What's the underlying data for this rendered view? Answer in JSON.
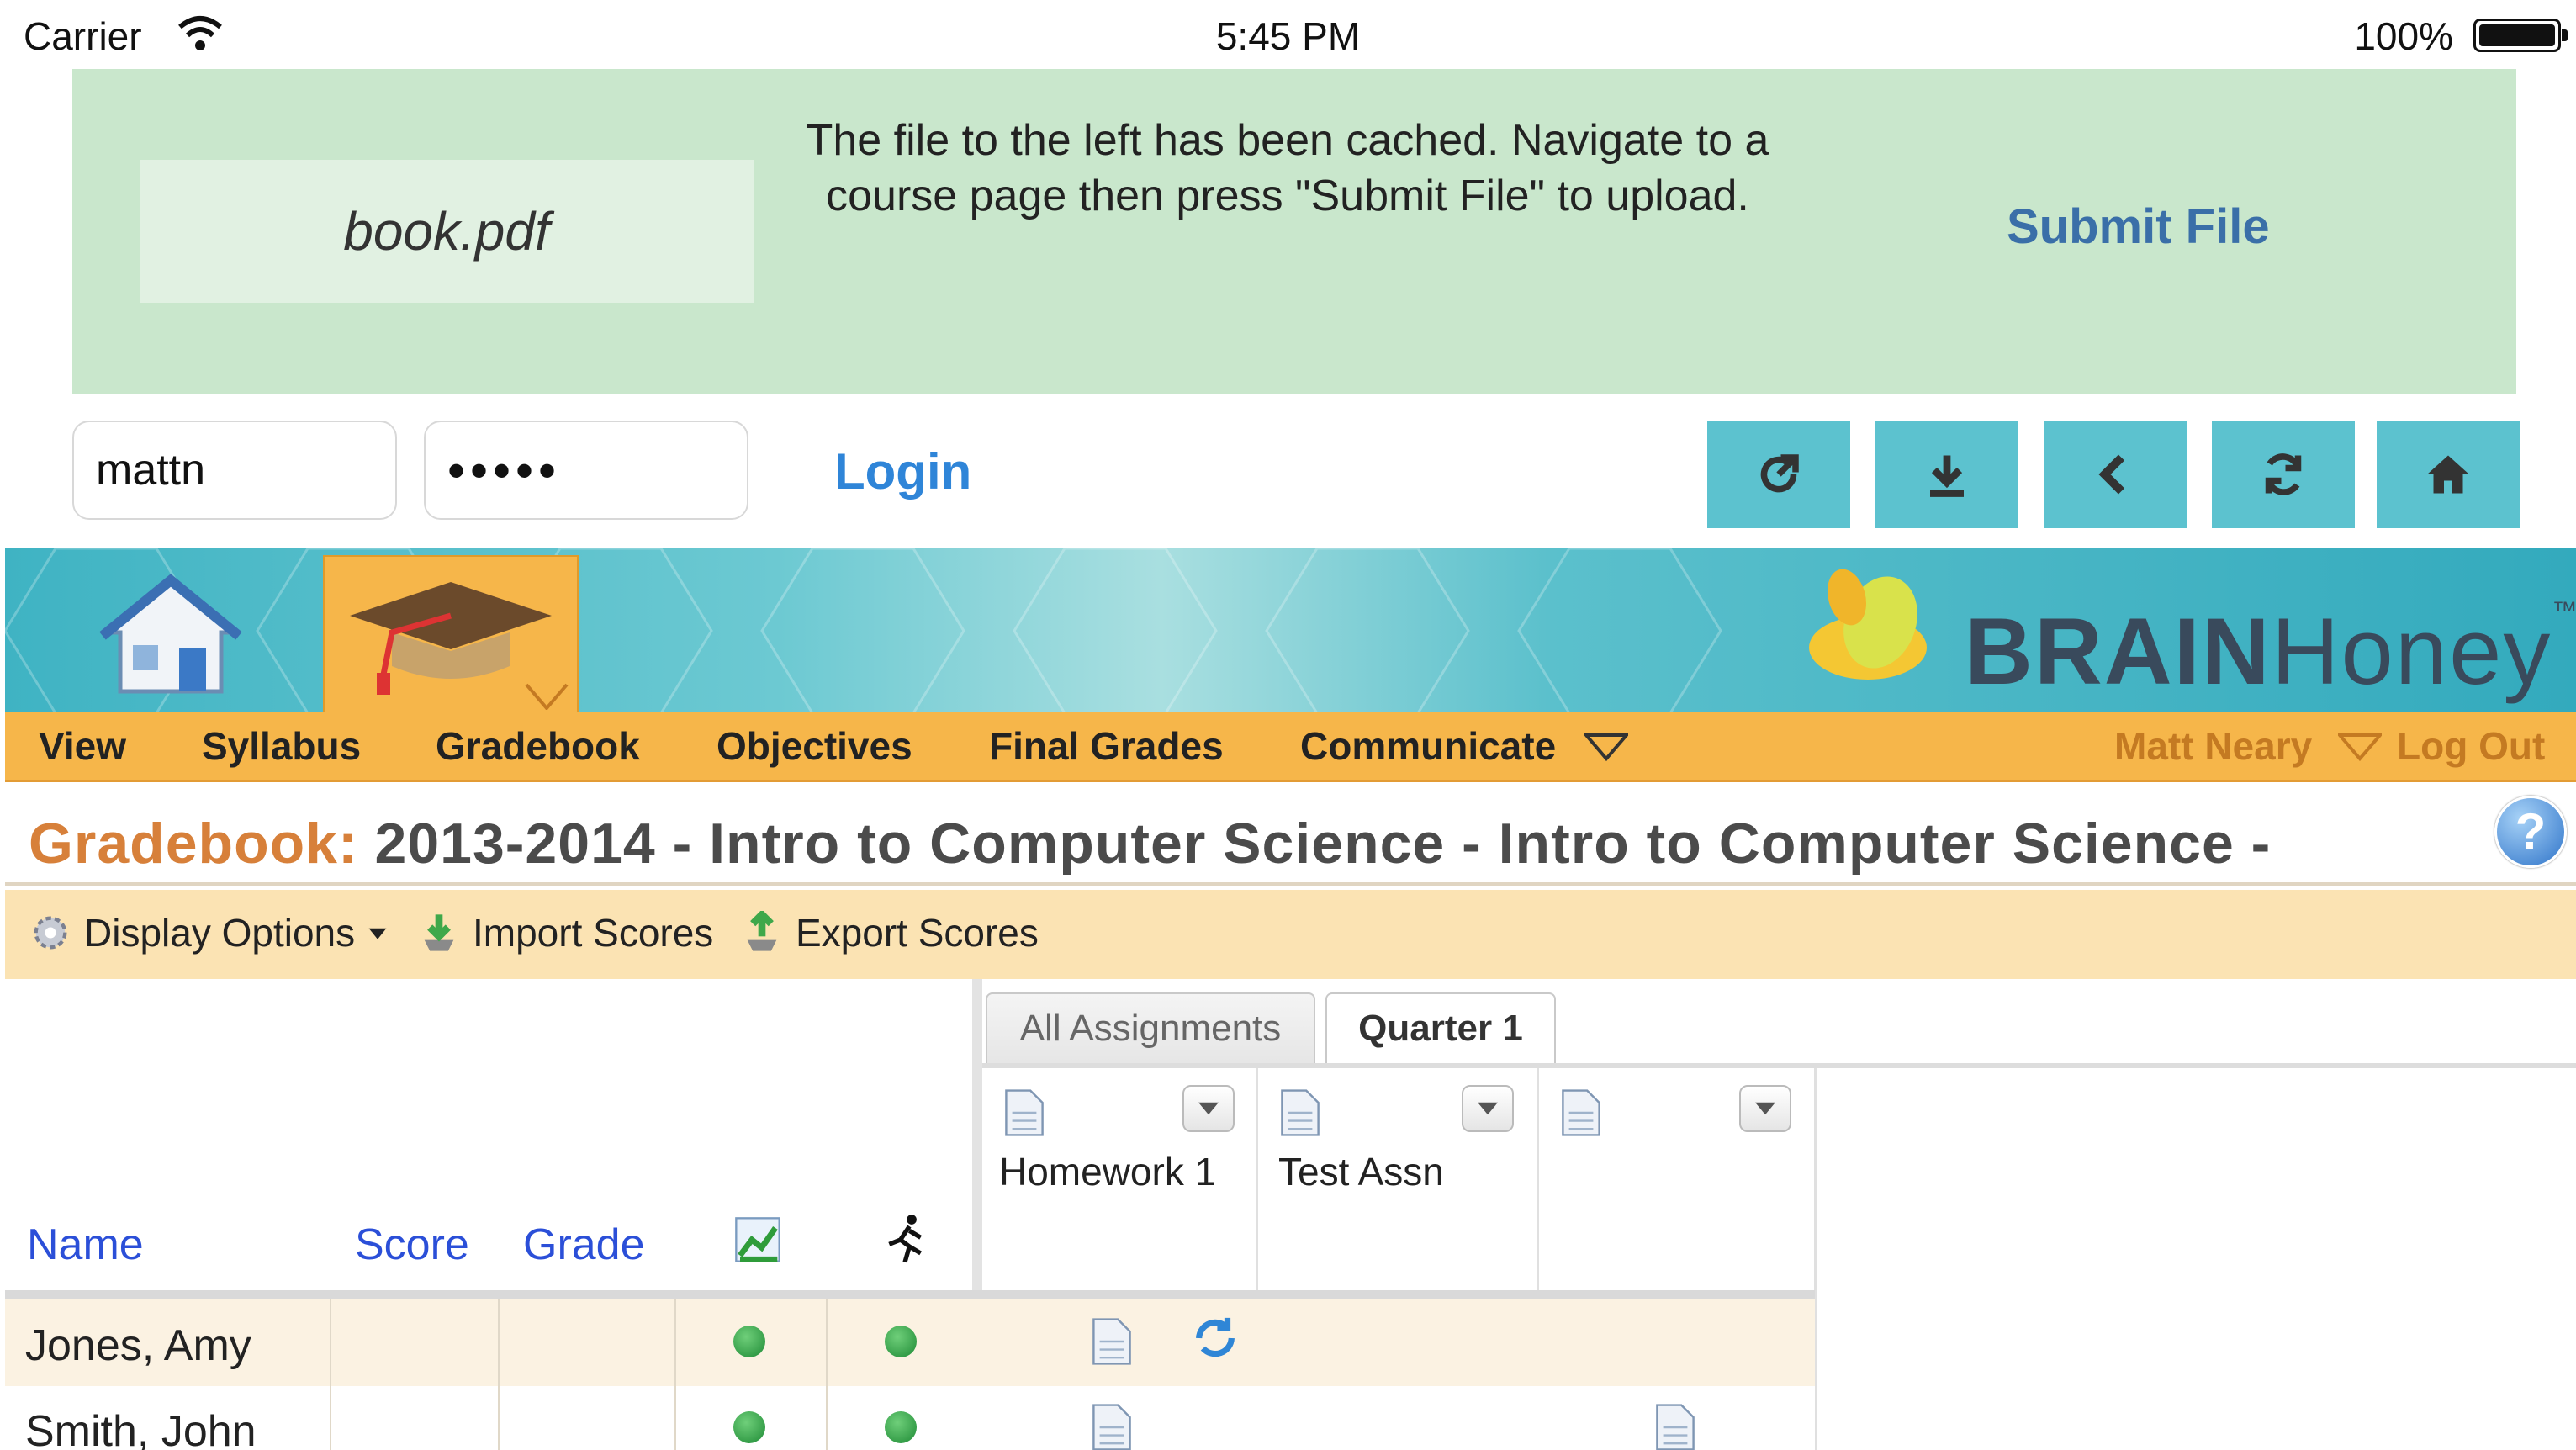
{
  "status_bar": {
    "carrier": "Carrier",
    "time": "5:45 PM",
    "battery": "100%"
  },
  "cache_banner": {
    "file_name": "book.pdf",
    "message": "The file to the left has been cached. Navigate to a course page then press \"Submit File\" to upload.",
    "submit_label": "Submit File"
  },
  "login": {
    "username": "mattn",
    "password_mask": "•••••",
    "login_label": "Login"
  },
  "toolbar_icons": [
    "share-icon",
    "download-icon",
    "back-icon",
    "refresh-icon",
    "home-icon"
  ],
  "brand": {
    "name_bold": "BRAIN",
    "name_light": "Honey",
    "trademark": "™"
  },
  "nav": {
    "items": [
      "View",
      "Syllabus",
      "Gradebook",
      "Objectives",
      "Final Grades",
      "Communicate"
    ],
    "user": "Matt Neary",
    "logout": "Log Out"
  },
  "page": {
    "title_label": "Gradebook:",
    "title_text": "2013-2014 - Intro to Computer Science - Intro to Computer Science -"
  },
  "options": {
    "display": "Display Options",
    "import": "Import Scores",
    "export": "Export Scores"
  },
  "grid": {
    "headers": {
      "name": "Name",
      "score": "Score",
      "grade": "Grade"
    },
    "tabs": [
      "All Assignments",
      "Quarter 1"
    ],
    "assignments": [
      "Homework 1",
      "Test Assn",
      ""
    ],
    "students": [
      "Jones, Amy",
      "Smith, John"
    ]
  },
  "colors": {
    "accent_orange": "#f6b64a",
    "banner_green": "#c9e7cc",
    "teal": "#5cc2cf",
    "link_blue": "#2b4fd8"
  }
}
